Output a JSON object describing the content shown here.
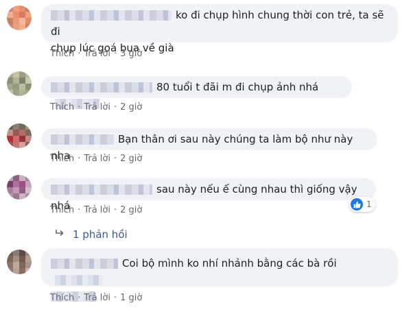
{
  "comments": [
    {
      "text_line1": "ko đi chụp hình chung thời con trẻ, ta sẽ đi",
      "text_line2": "chụp lúc goá bụa về già",
      "actions": {
        "like": "Thích",
        "reply": "Trả lời",
        "time": "3 giờ"
      }
    },
    {
      "text": "80 tuổi t đãi m đi chụp ảnh nhá",
      "actions": {
        "like": "Thích",
        "reply": "Trả lời",
        "time": "2 giờ"
      }
    },
    {
      "text": "Bạn thân ơi sau này chúng ta làm bộ như này nha",
      "actions": {
        "like": "Thích",
        "reply": "Trả lời",
        "time": "2 giờ"
      }
    },
    {
      "text": "sau này nếu ế cùng nhau thì giống vậy nhá",
      "actions": {
        "like": "Thích",
        "reply": "Trả lời",
        "time": "2 giờ"
      },
      "reaction": {
        "icon": "like-icon",
        "count": "1",
        "color": "#1877f2"
      }
    },
    {
      "text": "Coi bộ mình ko nhí nhảnh bằng các bà rồi",
      "actions": {
        "like": "Thích",
        "reply": "Trả lời",
        "time": "1 giờ"
      }
    }
  ],
  "replies": {
    "icon": "reply-arrow-icon",
    "label": "1 phản hồi"
  },
  "colors": {
    "bubble": "#f0f2f5",
    "text": "#1c1e21",
    "meta": "#65676b",
    "link": "#385898"
  }
}
